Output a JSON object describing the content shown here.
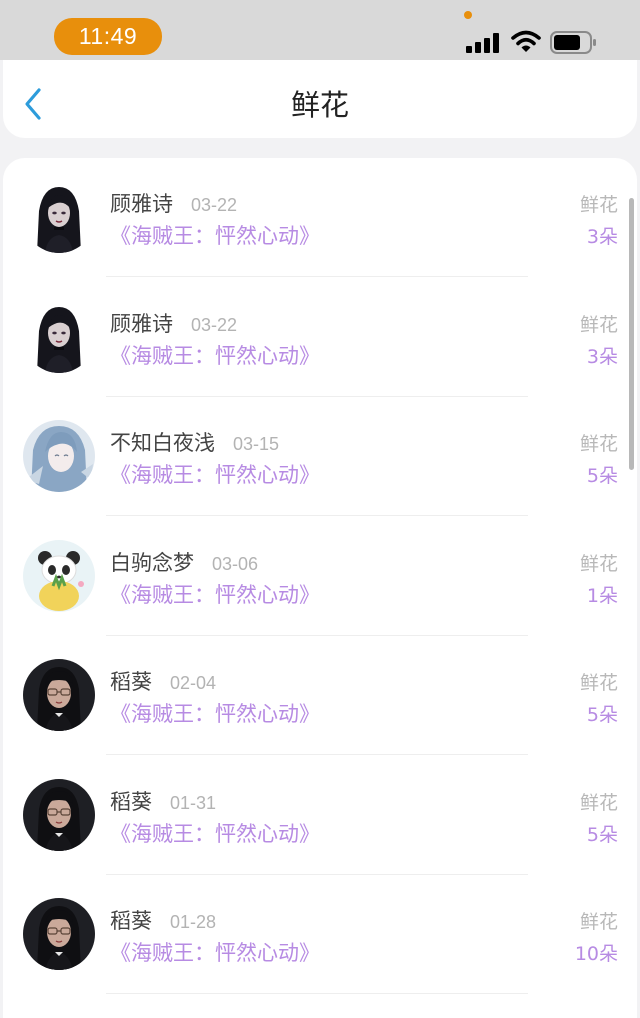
{
  "status_bar": {
    "time": "11:49",
    "accent_color": "#e88f0c",
    "icons": [
      "signal-icon",
      "wifi-icon",
      "battery-icon"
    ]
  },
  "header": {
    "title": "鲜花",
    "back_icon": "chevron-left-icon",
    "back_color": "#2d9cdb"
  },
  "colors": {
    "work_title": "#b78be3",
    "date": "#b3b3b3",
    "type_label": "#b8b8b8"
  },
  "items": [
    {
      "name": "顾雅诗",
      "date": "03-22",
      "work": "《海贼王：怦然心动》",
      "type": "鲜花",
      "count": "3朵",
      "avatar": "gothic-girl-avatar"
    },
    {
      "name": "顾雅诗",
      "date": "03-22",
      "work": "《海贼王：怦然心动》",
      "type": "鲜花",
      "count": "3朵",
      "avatar": "gothic-girl-avatar"
    },
    {
      "name": "不知白夜浅",
      "date": "03-15",
      "work": "《海贼王：怦然心动》",
      "type": "鲜花",
      "count": "5朵",
      "avatar": "anime-girl-avatar"
    },
    {
      "name": "白驹念梦",
      "date": "03-06",
      "work": "《海贼王：怦然心动》",
      "type": "鲜花",
      "count": "1朵",
      "avatar": "panda-avatar"
    },
    {
      "name": "稻葵",
      "date": "02-04",
      "work": "《海贼王：怦然心动》",
      "type": "鲜花",
      "count": "5朵",
      "avatar": "glasses-girl-avatar"
    },
    {
      "name": "稻葵",
      "date": "01-31",
      "work": "《海贼王：怦然心动》",
      "type": "鲜花",
      "count": "5朵",
      "avatar": "glasses-girl-avatar"
    },
    {
      "name": "稻葵",
      "date": "01-28",
      "work": "《海贼王：怦然心动》",
      "type": "鲜花",
      "count": "10朵",
      "avatar": "glasses-girl-avatar"
    }
  ]
}
